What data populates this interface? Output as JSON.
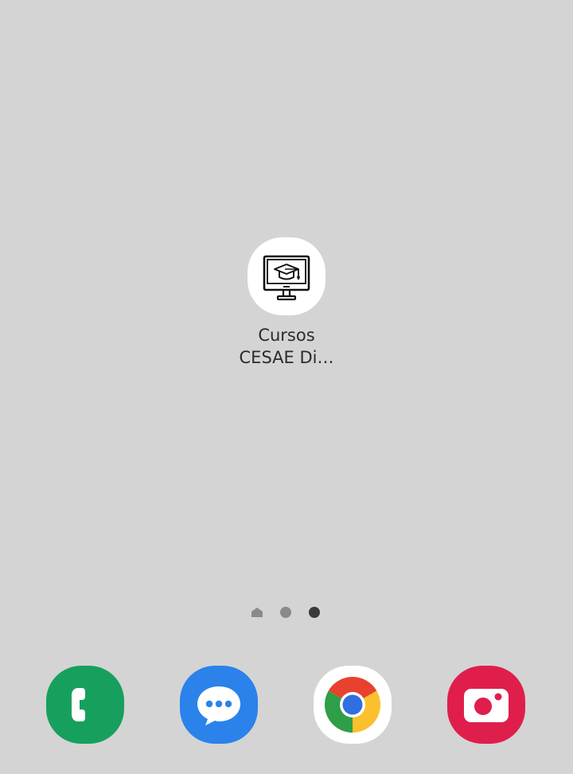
{
  "home_screen": {
    "app": {
      "label_line1": "Cursos",
      "label_line2": "CESAE Di…",
      "icon": "graduation-cap-monitor-icon"
    }
  },
  "page_indicator": {
    "pages": [
      "home",
      "page-2",
      "page-3"
    ],
    "current_page": 3
  },
  "dock": {
    "apps": [
      {
        "name": "Phone",
        "icon": "phone-icon",
        "color": "#17a05d"
      },
      {
        "name": "Messages",
        "icon": "message-bubble-icon",
        "color": "#2a82ea"
      },
      {
        "name": "Chrome",
        "icon": "chrome-icon",
        "color": "#ffffff"
      },
      {
        "name": "Camera",
        "icon": "camera-icon",
        "color": "#e01e4c"
      }
    ]
  },
  "colors": {
    "wallpaper": "#d4d4d4",
    "label_text": "#2b2b2b"
  }
}
